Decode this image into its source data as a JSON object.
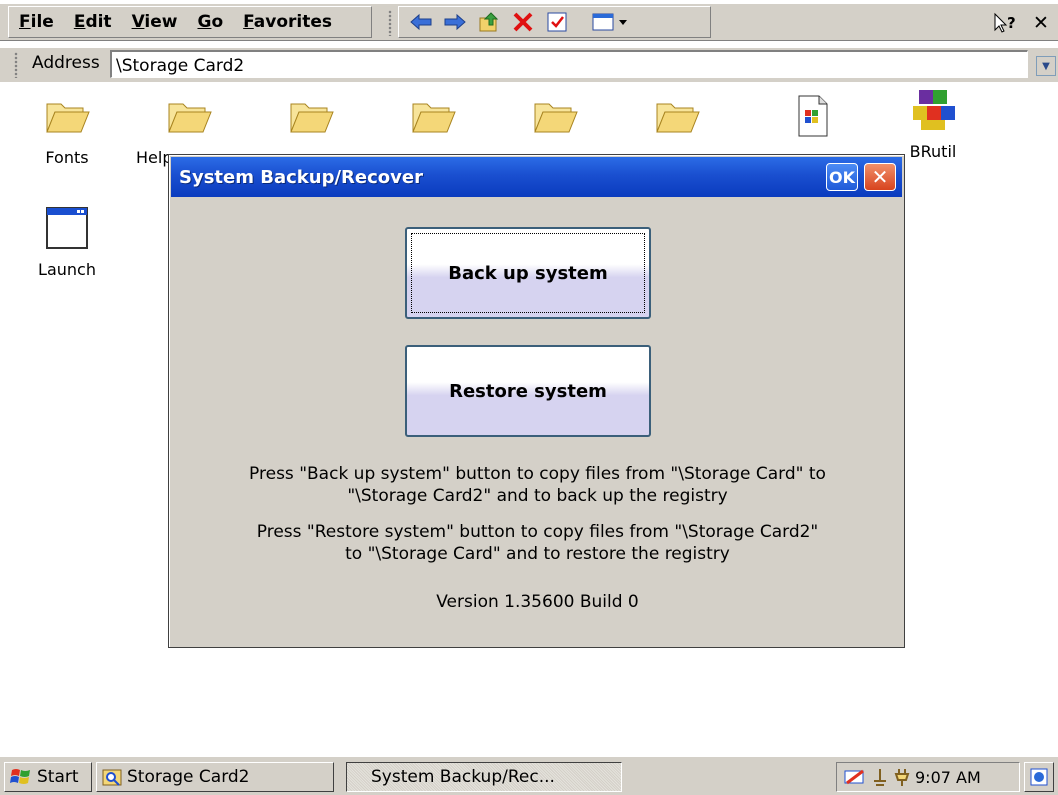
{
  "menubar": {
    "items": [
      "File",
      "Edit",
      "View",
      "Go",
      "Favorites"
    ]
  },
  "address": {
    "label": "Address",
    "value": "\\Storage Card2"
  },
  "desktop_icons": [
    {
      "label": "Fonts",
      "icon": "folder-icon"
    },
    {
      "label": "Help",
      "icon": "folder-icon"
    },
    {
      "label": "",
      "icon": "folder-icon"
    },
    {
      "label": "",
      "icon": "folder-icon"
    },
    {
      "label": "",
      "icon": "folder-icon"
    },
    {
      "label": "",
      "icon": "folder-icon"
    },
    {
      "label": "",
      "icon": "document-icon"
    },
    {
      "label": "BRutil",
      "icon": "brutil-icon"
    },
    {
      "label": "Launch",
      "icon": "window-icon"
    }
  ],
  "dialog": {
    "title": "System Backup/Recover",
    "ok_label": "OK",
    "backup_label": "Back up system",
    "restore_label": "Restore system",
    "backup_desc_line1": "Press \"Back up system\" button to copy files from \"\\Storage Card\" to",
    "backup_desc_line2": "\"\\Storage Card2\" and to back up the registry",
    "restore_desc_line1": "Press \"Restore system\" button to copy files from \"\\Storage Card2\"",
    "restore_desc_line2": "to \"\\Storage Card\" and to restore the registry",
    "version": "Version 1.35600 Build 0"
  },
  "taskbar": {
    "start_label": "Start",
    "tasks": [
      "Storage Card2",
      "System Backup/Rec..."
    ],
    "clock": "9:07 AM"
  },
  "colors": {
    "titlebar": "#0a3bbe",
    "button_fill": "#d6d3f0",
    "chrome": "#d4d0c8"
  }
}
